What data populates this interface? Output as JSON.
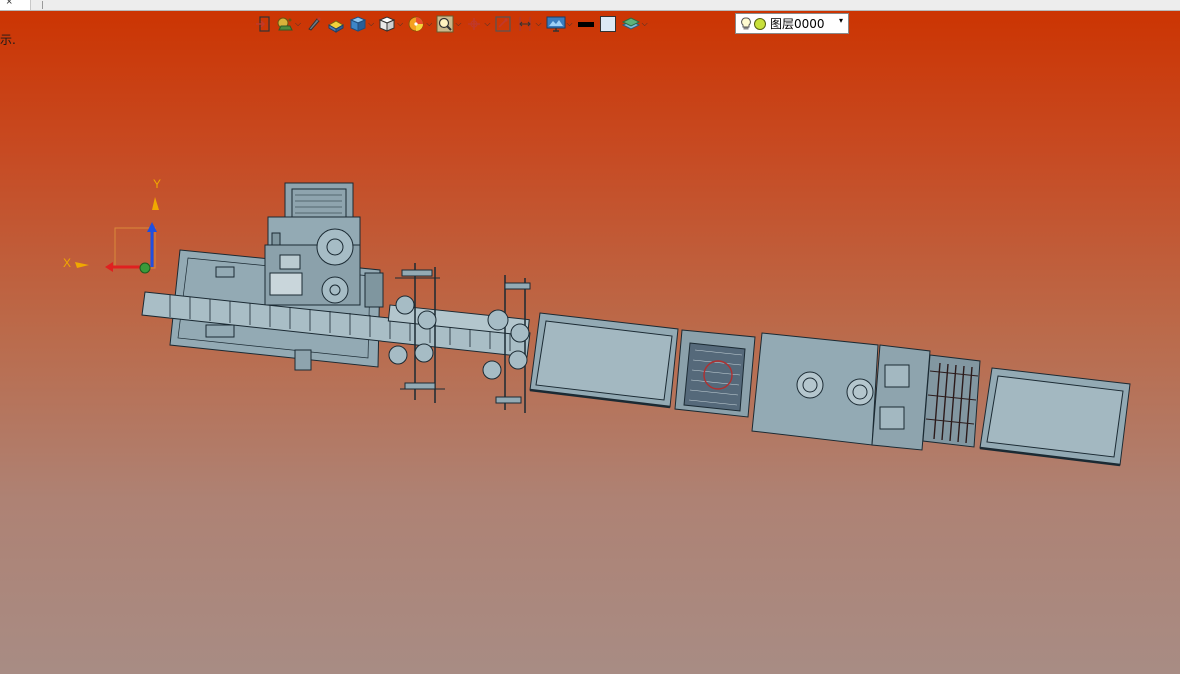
{
  "tabbar": {
    "active_tab_close": "×"
  },
  "hint": {
    "text": "示."
  },
  "toolbar": {
    "buttons": [
      {
        "name": "exit-icon",
        "has_dropdown": false
      },
      {
        "name": "snail-render-icon",
        "has_dropdown": true
      },
      {
        "name": "pen-icon",
        "has_dropdown": false
      },
      {
        "name": "material-block-icon",
        "has_dropdown": false
      },
      {
        "name": "blue-cube-icon",
        "has_dropdown": true
      },
      {
        "name": "white-cube-icon",
        "has_dropdown": true
      },
      {
        "name": "color-wheel-icon",
        "has_dropdown": true
      },
      {
        "name": "zoom-search-icon",
        "has_dropdown": true
      },
      {
        "name": "origin-crosshair-icon",
        "has_dropdown": true
      },
      {
        "name": "box-select-icon",
        "has_dropdown": false
      },
      {
        "name": "measure-icon",
        "has_dropdown": true
      },
      {
        "name": "display-monitor-icon",
        "has_dropdown": true
      },
      {
        "name": "line-color-swatch",
        "has_dropdown": false
      },
      {
        "name": "fill-color-swatch",
        "has_dropdown": false
      },
      {
        "name": "layer-stack-icon",
        "has_dropdown": true
      }
    ],
    "dropdown_glyph": "⌵"
  },
  "layer": {
    "name": "图层0000",
    "arrow": "▾"
  },
  "axes": {
    "x_label": "X",
    "y_label": "Y",
    "colors": {
      "x": "#e02020",
      "y": "#f0a800",
      "z": "#1f4fe0"
    }
  },
  "colors": {
    "model_fill": "#93aab4",
    "model_stroke": "#1b2a33",
    "bg_top": "#cc3300",
    "bg_bottom": "#a88c84"
  }
}
